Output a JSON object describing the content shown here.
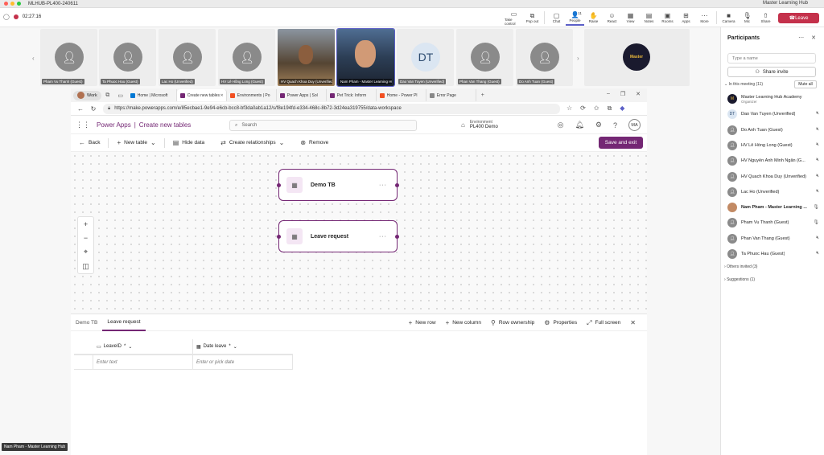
{
  "window": {
    "title": "MLHUB-PL400-240611",
    "right_title": "Master Learning Hub"
  },
  "teams": {
    "timer": "02:27:16",
    "tools": [
      {
        "label": "Take control",
        "icon": "▭"
      },
      {
        "label": "Pop out",
        "icon": "⧉"
      },
      {
        "label": "Chat",
        "icon": "▢"
      },
      {
        "label": "People",
        "icon": "👤",
        "badge": "11"
      },
      {
        "label": "Raise",
        "icon": "✋"
      },
      {
        "label": "React",
        "icon": "☺"
      },
      {
        "label": "View",
        "icon": "▦"
      },
      {
        "label": "Notes",
        "icon": "▤"
      },
      {
        "label": "Rooms",
        "icon": "▣"
      },
      {
        "label": "Apps",
        "icon": "⊞"
      },
      {
        "label": "More",
        "icon": "⋯"
      },
      {
        "label": "Camera",
        "icon": "■"
      },
      {
        "label": "Mic",
        "icon": "🎙"
      },
      {
        "label": "Share",
        "icon": "⇧"
      }
    ],
    "leave_label": "Leave"
  },
  "stage": {
    "tiles": [
      {
        "name": "Pham Vu Thanh (Guest)",
        "type": "avatar"
      },
      {
        "name": "Ta Phuoc Hau (Guest)",
        "type": "avatar"
      },
      {
        "name": "Lac Ho (Unverified)",
        "type": "avatar"
      },
      {
        "name": "HV Lê Hồng Long (Guest)",
        "type": "avatar"
      },
      {
        "name": "HV Quach Khoa Duy (Unverified)",
        "type": "video"
      },
      {
        "name": "Nam Pham - Master Learning Hub",
        "type": "video2"
      },
      {
        "name": "Dao Van Tuyen (Unverified)",
        "type": "dt",
        "initials": "DT"
      },
      {
        "name": "Phan Van Thang (Guest)",
        "type": "avatar"
      },
      {
        "name": "Do Anh Tuan (Guest)",
        "type": "avatar"
      }
    ],
    "logo_text": "Master",
    "presenter_label": "Nam Pham - Master Learning Hub"
  },
  "browser": {
    "profile_label": "Work",
    "tabs": [
      {
        "label": "Home | Microsoft",
        "color": "#0078d4"
      },
      {
        "label": "Create new tables",
        "color": "#742774",
        "active": true
      },
      {
        "label": "Environments | Po",
        "color": "#f25022"
      },
      {
        "label": "Power Apps | Sol",
        "color": "#742774"
      },
      {
        "label": "Pet Trick: Inform",
        "color": "#742774"
      },
      {
        "label": "Home - Power Pl",
        "color": "#f25022"
      },
      {
        "label": "Error Page",
        "color": "#888888"
      }
    ],
    "url": "https://make.powerapps.com/e/85ecbae1-9e94-e6cb-bcc8-bf3da0ab1a12/s/f8e194fd-e334-468c-8b72-3d24ea319755/data-workspace"
  },
  "powerapps": {
    "app_name": "Power Apps",
    "page_name": "Create new tables",
    "search_placeholder": "Search",
    "env_label": "Environment",
    "env_value": "PL400 Demo",
    "user_initials": "MA",
    "commands": [
      "Back",
      "New table",
      "Hide data",
      "Create relationships",
      "Remove"
    ],
    "save_exit": "Save and exit",
    "tables": [
      {
        "name": "Demo TB"
      },
      {
        "name": "Leave request"
      }
    ],
    "bottom_tabs": [
      "Demo TB",
      "Leave request"
    ],
    "bottom_actions": [
      "New row",
      "New column",
      "Row ownership",
      "Properties",
      "Full screen"
    ],
    "grid": {
      "columns": [
        {
          "label": "LeaveID",
          "suffix": "*"
        },
        {
          "label": "Date leave",
          "suffix": "*"
        }
      ],
      "placeholders": [
        "Enter text",
        "Enter or pick date"
      ]
    }
  },
  "participants": {
    "title": "Participants",
    "search_placeholder": "Type a name",
    "invite_label": "Share invite",
    "in_meeting_label": "In this meeting (11)",
    "mute_all": "Mute all",
    "people": [
      {
        "name": "Master Learning Hub Academy",
        "sub": "Organizer",
        "type": "org"
      },
      {
        "name": "Dao Van Tuyen (Unverified)",
        "type": "dt",
        "initials": "DT"
      },
      {
        "name": "Do Anh Tuan (Guest)",
        "type": "avatar"
      },
      {
        "name": "HV Lê Hồng Long (Guest)",
        "type": "avatar"
      },
      {
        "name": "HV Nguyễn Ánh Minh Ngân (G...",
        "type": "avatar"
      },
      {
        "name": "HV Quach Khoa Duy (Unverified)",
        "type": "avatar"
      },
      {
        "name": "Lac Ho (Unverified)",
        "type": "avatar"
      },
      {
        "name": "Nam Pham - Master Learning ...",
        "type": "face",
        "bold": true
      },
      {
        "name": "Pham Vu Thanh (Guest)",
        "type": "avatar"
      },
      {
        "name": "Phan Van Thang (Guest)",
        "type": "avatar"
      },
      {
        "name": "Ta Phuoc Hau (Guest)",
        "type": "avatar"
      }
    ],
    "others_label": "Others invited (3)",
    "suggestions_label": "Suggestions (1)"
  }
}
